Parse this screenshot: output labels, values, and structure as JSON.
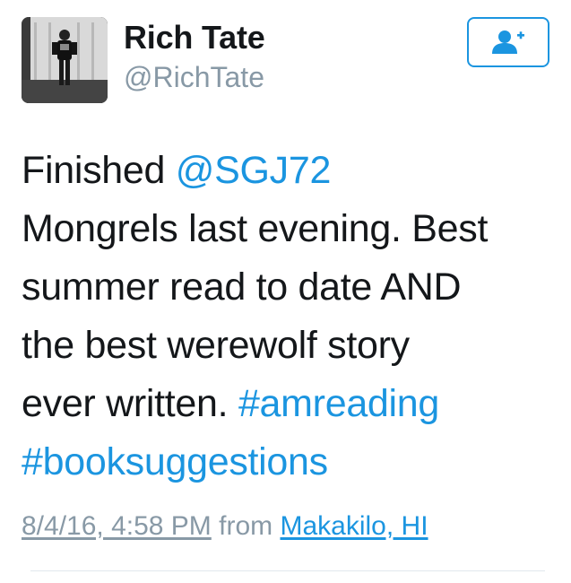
{
  "user": {
    "display_name": "Rich Tate",
    "username": "@RichTate"
  },
  "follow_button": {
    "icon": "add-user-icon",
    "color": "#1b95e0"
  },
  "tweet": {
    "lines": [
      [
        {
          "text": "Finished ",
          "link": false
        },
        {
          "text": "@SGJ72",
          "link": true
        }
      ],
      [
        {
          "text": "Mongrels last evening. Best",
          "link": false
        }
      ],
      [
        {
          "text": "summer read to date AND",
          "link": false
        }
      ],
      [
        {
          "text": "the best werewolf story",
          "link": false
        }
      ],
      [
        {
          "text": "ever written. ",
          "link": false
        },
        {
          "text": "#amreading",
          "link": true
        }
      ],
      [
        {
          "text": "#booksuggestions",
          "link": true
        }
      ]
    ]
  },
  "meta": {
    "timestamp": "8/4/16, 4:58 PM",
    "from_label": " from ",
    "place": "Makakilo, HI"
  },
  "colors": {
    "link": "#1b95e0",
    "secondary": "#8899a6",
    "text": "#14171a"
  }
}
